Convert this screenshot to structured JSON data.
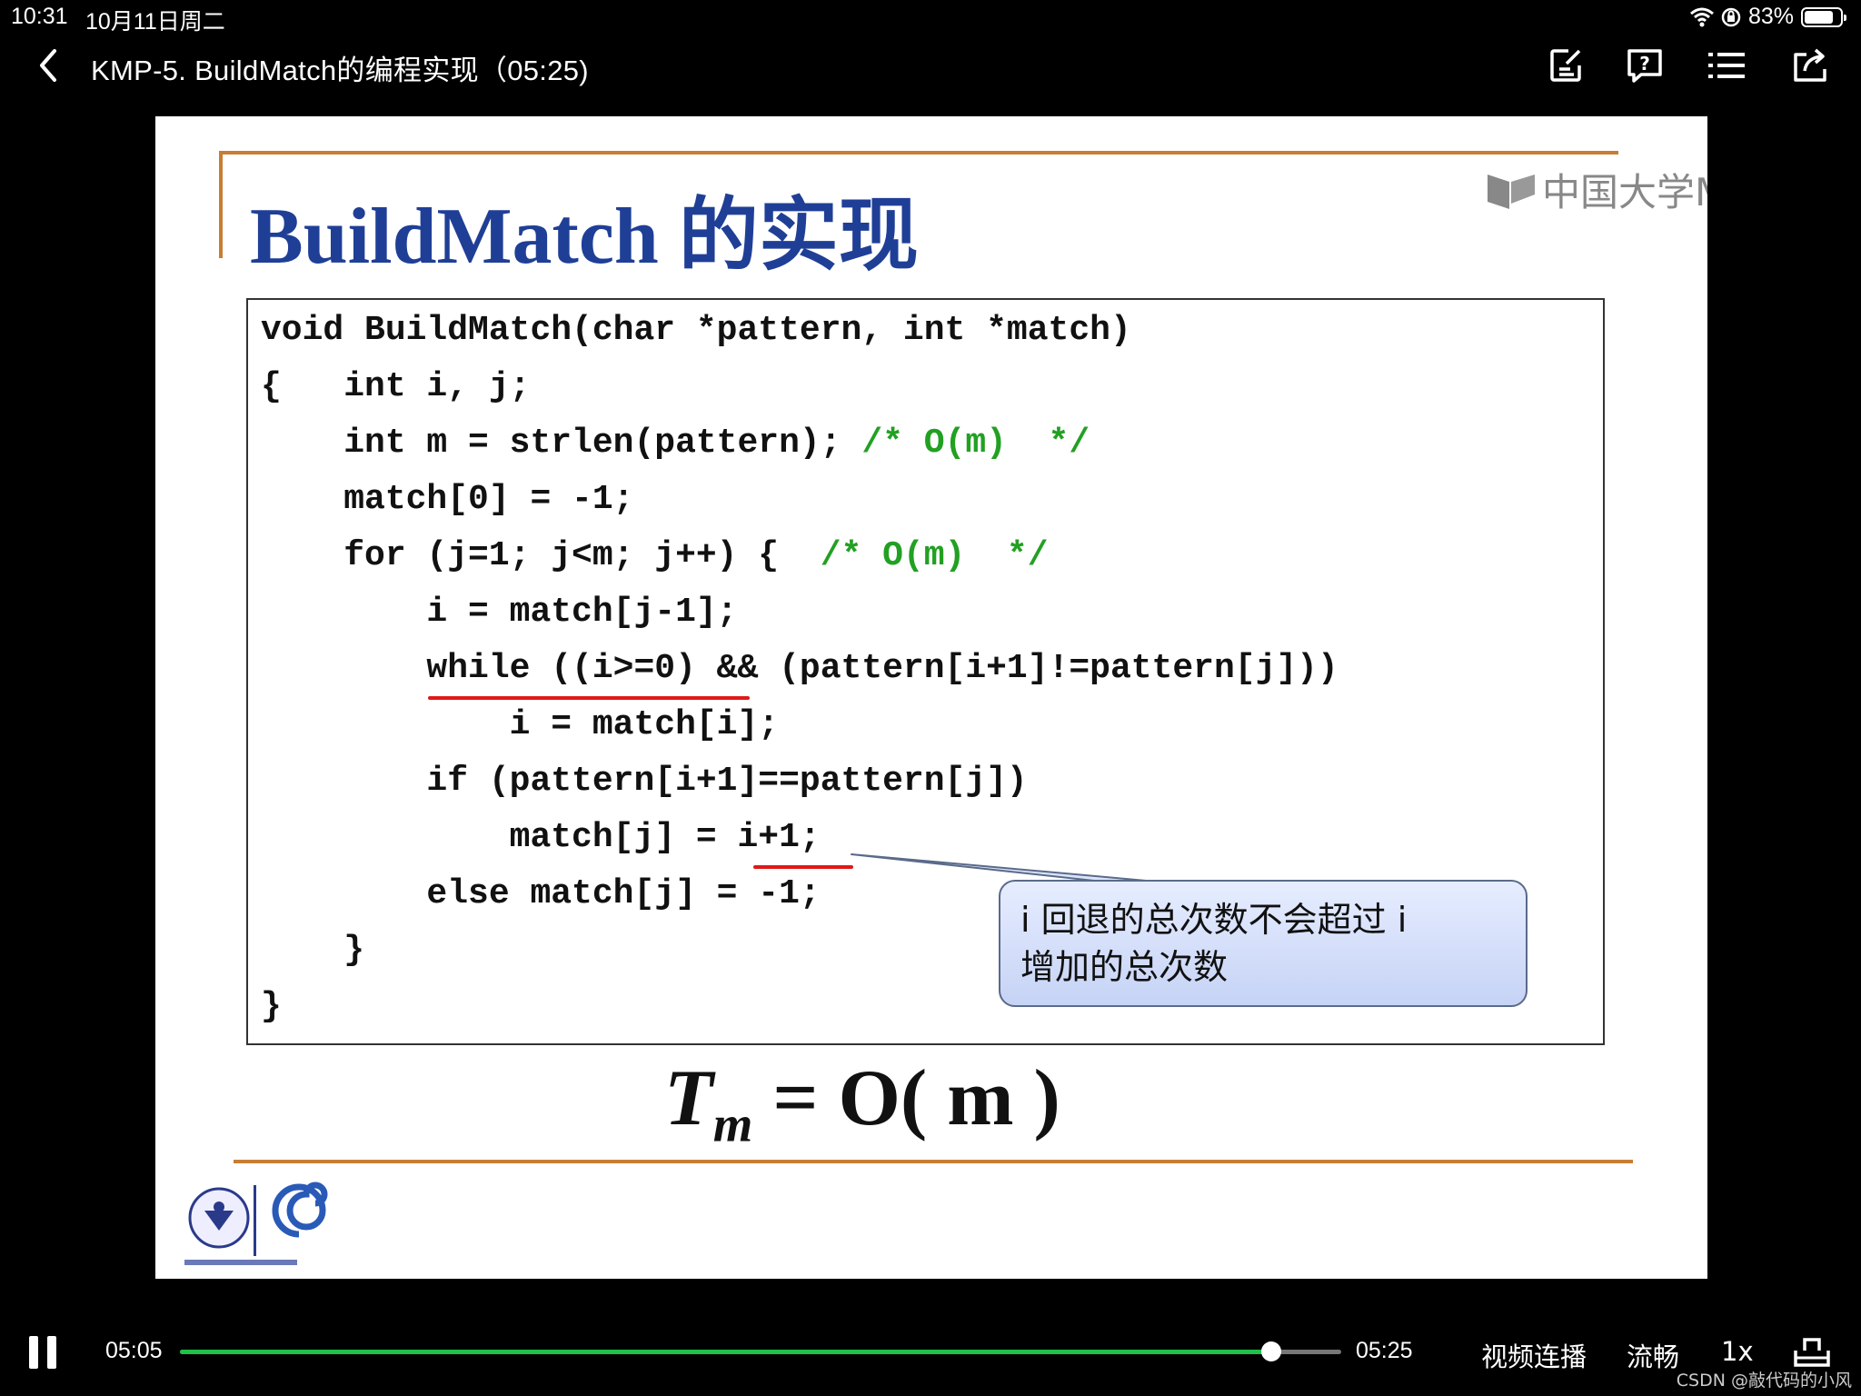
{
  "status_bar": {
    "time": "10:31",
    "date": "10月11日周二",
    "battery": "83%",
    "battery_level": 0.83
  },
  "header": {
    "title": "KMP-5. BuildMatch的编程实现（05:25)",
    "icons": [
      "back-icon",
      "note-edit-icon",
      "question-icon",
      "list-icon",
      "share-icon"
    ]
  },
  "slide": {
    "title": "BuildMatch 的实现",
    "watermark": "中国大学M",
    "code": {
      "line1": "void BuildMatch(char *pattern, int *match)",
      "line2": "{   int i, j;",
      "line3": "    int m = strlen(pattern);",
      "line3_comment": " /* O(m)  */",
      "line4": "    match[0] = -1;",
      "line5": "    for (j=1; j<m; j++) {",
      "line5_comment": "  /* O(m)  */",
      "line6": "        i = match[j-1];",
      "line7": "        while ((i>=0) && (pattern[i+1]!=pattern[j]))",
      "line8": "            i = match[i];",
      "line9": "        if (pattern[i+1]==pattern[j])",
      "line10": "            match[j] = i+1;",
      "line11": "        else match[j] = -1;",
      "line12": "    }",
      "line13": "}"
    },
    "callout": {
      "line1": "i 回退的总次数不会超过 i",
      "line2": "增加的总次数"
    },
    "formula": {
      "t": "T",
      "sub": "m",
      "rest": " = O( m )"
    }
  },
  "player": {
    "current_time": "05:05",
    "total_time": "05:25",
    "progress": 0.94,
    "continuous_play": "视频连播",
    "quality": "流畅",
    "speed": "1x",
    "watermark": "CSDN @敲代码的小风"
  },
  "colors": {
    "accent": "#21c04a",
    "slide_title": "#1f3f97",
    "rule_line": "#c87d33",
    "comment": "#22a022",
    "highlight": "#e01818"
  }
}
